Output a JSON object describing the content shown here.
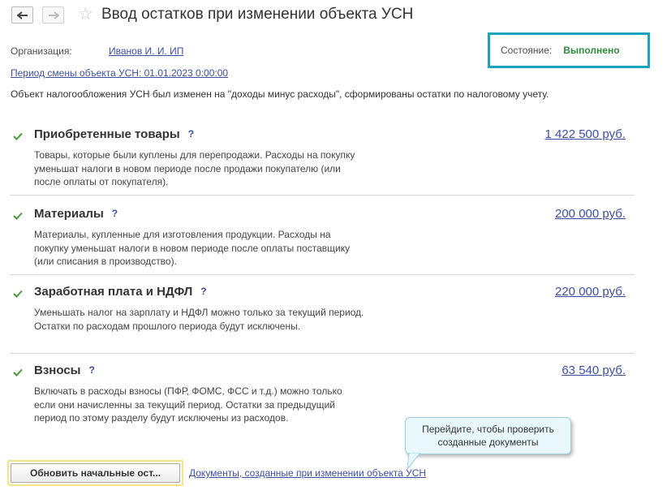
{
  "header": {
    "title": "Ввод остатков при изменении объекта УСН"
  },
  "organization": {
    "label": "Организация:",
    "value": "Иванов И. И. ИП"
  },
  "period_link": "Период смены объекта УСН: 01.01.2023 0:00:00",
  "state": {
    "label": "Состояние:",
    "value": "Выполнено",
    "value_color": "#2e8b3d",
    "box_color": "#1aa3bd"
  },
  "info_text": "Объект налогообложения УСН был изменен на \"доходы минус расходы\", сформированы остатки по налоговому учету.",
  "sections": [
    {
      "title": "Приобретенные товары",
      "help": "?",
      "description": "Товары, которые были куплены для перепродажи. Расходы на покупку уменьшат налоги в новом периоде после продажи покупателю (или после оплаты от покупателя).",
      "amount": "1 422 500 руб."
    },
    {
      "title": "Материалы",
      "help": "?",
      "description": "Материалы, купленные для изготовления продукции. Расходы на покупку уменьшат налоги в новом периоде после оплаты поставщику (или списания в производство).",
      "amount": "200 000 руб."
    },
    {
      "title": "Заработная плата и НДФЛ",
      "help": "?",
      "description": "Уменьшать налог на зарплату и НДФЛ можно только за текущий период. Остатки по расходам прошлого периода будут исключены.",
      "amount": "220 000 руб."
    },
    {
      "title": "Взносы",
      "help": "?",
      "description": "Включать в расходы взносы (ПФР, ФОМС, ФСС и т.д.) можно только если они начисленны за текущий период. Остатки за предыдущий период по этому разделу будут исключены из расходов.",
      "amount": "63 540 руб."
    }
  ],
  "tooltip": {
    "line1": "Перейдите, чтобы проверить",
    "line2": "созданные документы"
  },
  "bottom": {
    "update_button": "Обновить начальные ост...",
    "documents_link": "Документы, созданные при изменении объекта УСН"
  },
  "colors": {
    "link": "#3c4fa3",
    "check": "#4a9a3a",
    "divider": "#d6d6d6"
  },
  "icons": [
    "back-arrow-icon",
    "forward-arrow-icon",
    "favorite-star-icon",
    "check-icon"
  ]
}
